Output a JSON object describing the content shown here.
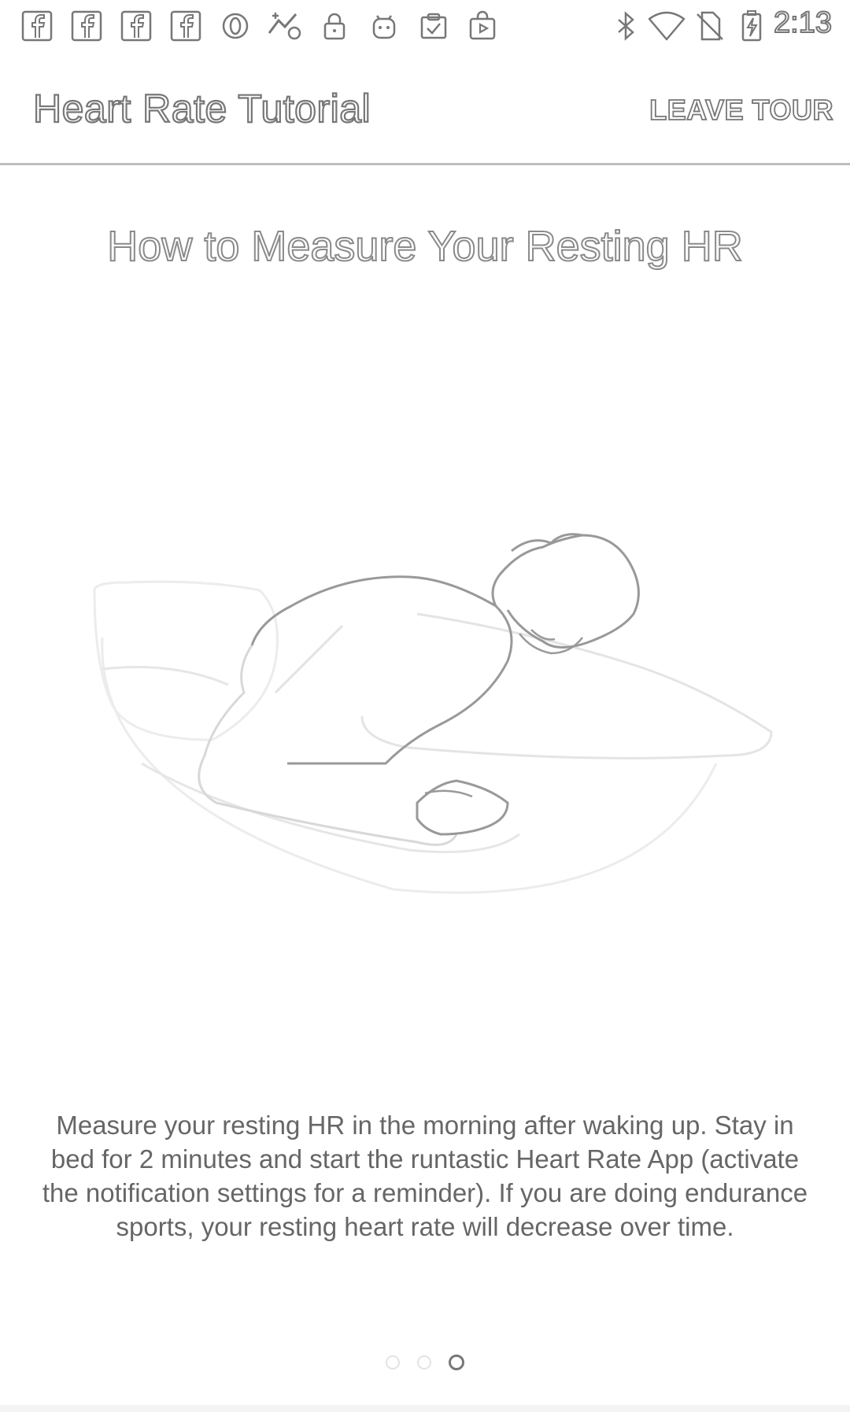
{
  "status_bar": {
    "time": "2:13",
    "icons_left": [
      "facebook-icon",
      "facebook-icon",
      "facebook-icon",
      "facebook-icon",
      "opera-icon",
      "fake-gps-icon",
      "lock-icon",
      "android-icon",
      "clipboard-check-icon",
      "play-store-icon"
    ],
    "icons_right": [
      "bluetooth-icon",
      "wifi-icon",
      "no-sim-icon",
      "battery-charging-icon"
    ]
  },
  "app_bar": {
    "title": "Heart Rate Tutorial",
    "leave_tour_label": "LEAVE TOUR"
  },
  "page": {
    "heading": "How to Measure Your Resting HR",
    "illustration": "person-sleeping-in-bed-illustration",
    "body": "Measure your resting HR in the morning after waking up. Stay in bed for 2 minutes and start the runtastic Heart Rate App (activate the notification settings for a reminder). If you are doing endurance sports, your resting heart rate will decrease over time."
  },
  "pager": {
    "total": 3,
    "active_index": 2
  },
  "colors": {
    "outline": "#777777",
    "body_text": "#666666",
    "divider": "#bdbdbd"
  }
}
